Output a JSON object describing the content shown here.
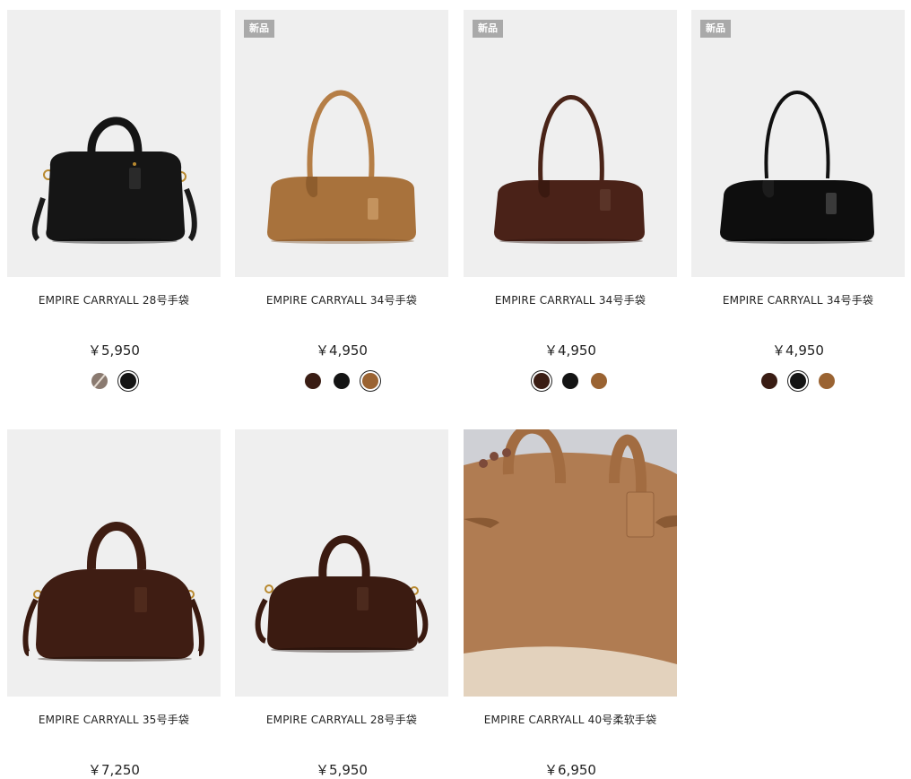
{
  "colors": {
    "black": "#141414",
    "chestnut": "#3a1d14",
    "tan": "#9a6332",
    "taupe": "#8a7a70"
  },
  "products": [
    {
      "name": "EMPIRE CARRYALL 28号手袋",
      "price": "￥5,950",
      "badge": "",
      "image": "black-28-bag",
      "swatches": [
        "taupe-split",
        "black"
      ],
      "selected": 1
    },
    {
      "name": "EMPIRE CARRYALL 34号手袋",
      "price": "￥4,950",
      "badge": "新品",
      "image": "tan-34-bag",
      "swatches": [
        "chestnut",
        "black",
        "tan"
      ],
      "selected": 2
    },
    {
      "name": "EMPIRE CARRYALL 34号手袋",
      "price": "￥4,950",
      "badge": "新品",
      "image": "chestnut-34-bag",
      "swatches": [
        "chestnut",
        "black",
        "tan"
      ],
      "selected": 0
    },
    {
      "name": "EMPIRE CARRYALL 34号手袋",
      "price": "￥4,950",
      "badge": "新品",
      "image": "black-34-bag",
      "swatches": [
        "chestnut",
        "black",
        "tan"
      ],
      "selected": 1
    },
    {
      "name": "EMPIRE CARRYALL 35号手袋",
      "price": "￥7,250",
      "badge": "",
      "image": "chestnut-35-bag",
      "swatches": [],
      "selected": -1
    },
    {
      "name": "EMPIRE CARRYALL 28号手袋",
      "price": "￥5,950",
      "badge": "",
      "image": "chestnut-28-bag",
      "swatches": [],
      "selected": -1
    },
    {
      "name": "EMPIRE CARRYALL 40号柔软手袋",
      "price": "￥6,950",
      "badge": "",
      "image": "tan-40-soft-bag-lifestyle",
      "swatches": [],
      "selected": -1
    }
  ]
}
